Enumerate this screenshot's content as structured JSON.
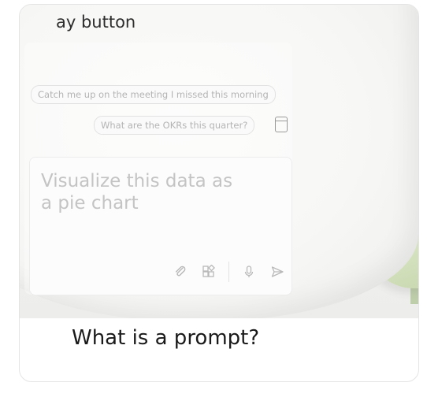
{
  "hero": {
    "heading_fragment": "ay button",
    "suggestions": [
      "Catch me up on the meeting I missed this morning",
      "What are the OKRs this quarter?"
    ],
    "suggestion_icon": "document-icon",
    "input_text": "Visualize this data as a pie chart",
    "toolbar_icons": [
      "paperclip-icon",
      "grid-icon",
      "microphone-icon",
      "send-icon"
    ]
  },
  "card": {
    "title": "What is a prompt?"
  }
}
